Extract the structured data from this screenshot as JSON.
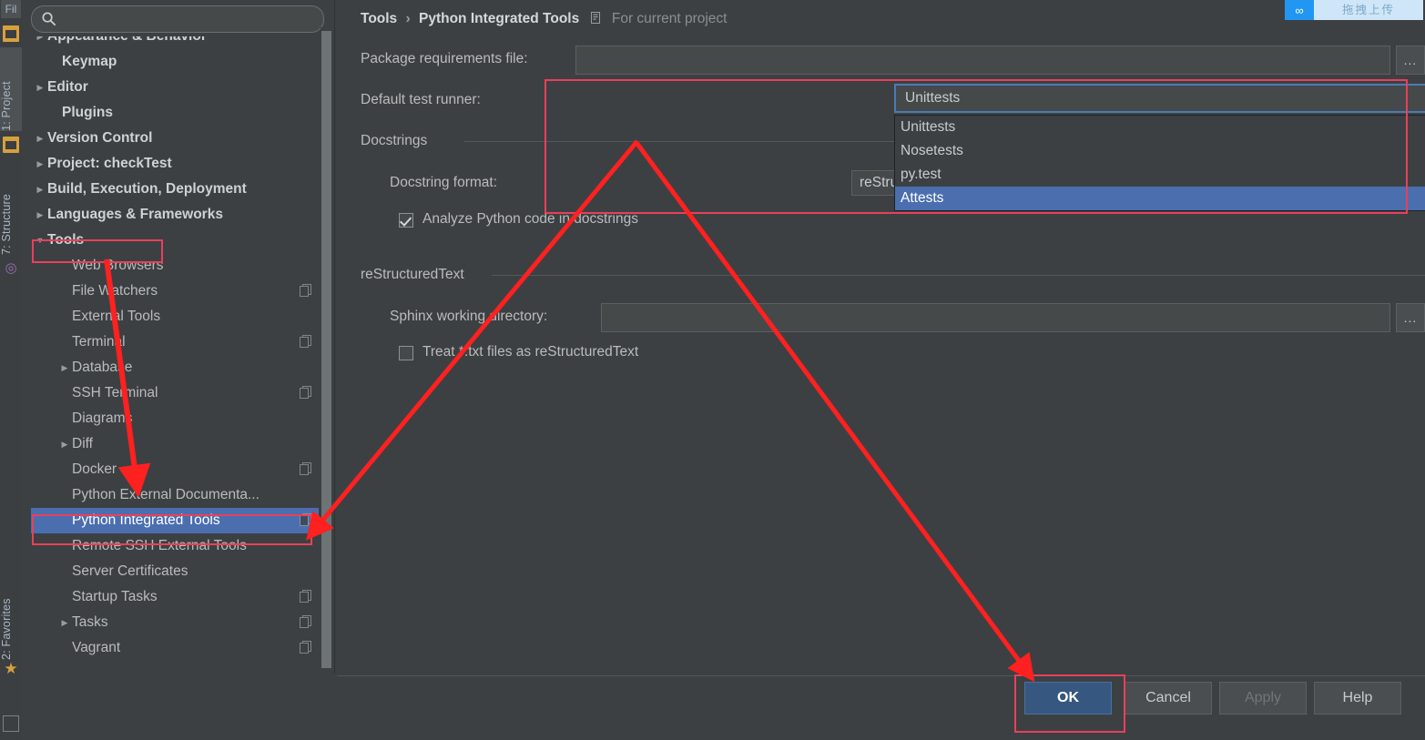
{
  "window": {
    "background_color": "#3c4043",
    "accent_selection": "#4b6eaf",
    "primary_button_color": "#365880",
    "annotation_color": "#ff2020"
  },
  "gutter": {
    "top_label": "Fil",
    "tabs": [
      {
        "label": "1: Project",
        "selected": true
      },
      {
        "label": "7: Structure",
        "selected": false
      },
      {
        "label": "2: Favorites",
        "selected": false
      }
    ],
    "icons": [
      "folder-icon",
      "project-icon",
      "structure-node-icon",
      "favorites-star-icon"
    ]
  },
  "search": {
    "value": "",
    "placeholder": "",
    "icon": "search-icon"
  },
  "tree": {
    "items": [
      {
        "label": "Appearance & Behavior",
        "arrow": "▶",
        "bold": true,
        "indent": 18,
        "clipped": true,
        "copy": false
      },
      {
        "label": "Keymap",
        "arrow": "",
        "bold": true,
        "indent": 34,
        "copy": false
      },
      {
        "label": "Editor",
        "arrow": "▶",
        "bold": true,
        "indent": 18,
        "copy": false
      },
      {
        "label": "Plugins",
        "arrow": "",
        "bold": true,
        "indent": 34,
        "copy": false
      },
      {
        "label": "Version Control",
        "arrow": "▶",
        "bold": true,
        "indent": 18,
        "copy": false
      },
      {
        "label": "Project: checkTest",
        "arrow": "▶",
        "bold": true,
        "indent": 18,
        "copy": false
      },
      {
        "label": "Build, Execution, Deployment",
        "arrow": "▶",
        "bold": true,
        "indent": 18,
        "copy": false
      },
      {
        "label": "Languages & Frameworks",
        "arrow": "▶",
        "bold": true,
        "indent": 18,
        "copy": false
      },
      {
        "label": "Tools",
        "arrow": "▼",
        "bold": true,
        "indent": 18,
        "copy": false,
        "boxed": true
      },
      {
        "label": "Web Browsers",
        "arrow": "",
        "bold": false,
        "indent": 45,
        "copy": false
      },
      {
        "label": "File Watchers",
        "arrow": "",
        "bold": false,
        "indent": 45,
        "copy": true
      },
      {
        "label": "External Tools",
        "arrow": "",
        "bold": false,
        "indent": 45,
        "copy": false
      },
      {
        "label": "Terminal",
        "arrow": "",
        "bold": false,
        "indent": 45,
        "copy": true
      },
      {
        "label": "Database",
        "arrow": "▶",
        "bold": false,
        "indent": 45,
        "copy": false
      },
      {
        "label": "SSH Terminal",
        "arrow": "",
        "bold": false,
        "indent": 45,
        "copy": true
      },
      {
        "label": "Diagrams",
        "arrow": "",
        "bold": false,
        "indent": 45,
        "copy": false
      },
      {
        "label": "Diff",
        "arrow": "▶",
        "bold": false,
        "indent": 45,
        "copy": false
      },
      {
        "label": "Docker",
        "arrow": "",
        "bold": false,
        "indent": 45,
        "copy": true
      },
      {
        "label": "Python External Documenta...",
        "arrow": "",
        "bold": false,
        "indent": 45,
        "copy": false
      },
      {
        "label": "Python Integrated Tools",
        "arrow": "",
        "bold": false,
        "indent": 45,
        "copy": true,
        "selected": true
      },
      {
        "label": "Remote SSH External Tools",
        "arrow": "",
        "bold": false,
        "indent": 45,
        "copy": false
      },
      {
        "label": "Server Certificates",
        "arrow": "",
        "bold": false,
        "indent": 45,
        "copy": false
      },
      {
        "label": "Startup Tasks",
        "arrow": "",
        "bold": false,
        "indent": 45,
        "copy": true
      },
      {
        "label": "Tasks",
        "arrow": "▶",
        "bold": false,
        "indent": 45,
        "copy": true
      },
      {
        "label": "Vagrant",
        "arrow": "",
        "bold": false,
        "indent": 45,
        "copy": true
      }
    ]
  },
  "breadcrumb": {
    "root": "Tools",
    "separator": "›",
    "current": "Python Integrated Tools",
    "scope_icon": "project-scope-icon",
    "scope_text": "For current project"
  },
  "form": {
    "package_requirements_label": "Package requirements file:",
    "package_requirements_value": "",
    "package_browse_label": "...",
    "default_test_runner_label": "Default test runner:",
    "default_test_runner_value": "Unittests",
    "test_runner_options": [
      "Unittests",
      "Nosetests",
      "py.test",
      "Attests"
    ],
    "test_runner_highlighted": "Attests",
    "docstrings_group": "Docstrings",
    "docstring_format_label": "Docstring format:",
    "docstring_format_value": "reStructuredText",
    "analyze_code_label": "Analyze Python code in docstrings",
    "analyze_code_checked": true,
    "rest_group": "reStructuredText",
    "sphinx_label": "Sphinx working directory:",
    "sphinx_value": "",
    "sphinx_browse_label": "...",
    "treat_txt_label": "Treat *.txt files as reStructuredText",
    "treat_txt_checked": false
  },
  "buttons": {
    "ok": "OK",
    "cancel": "Cancel",
    "apply": "Apply",
    "help": "Help",
    "apply_disabled": true
  },
  "upload_badge": {
    "icon": "infinity-upload-icon",
    "text": "拖拽上传"
  }
}
